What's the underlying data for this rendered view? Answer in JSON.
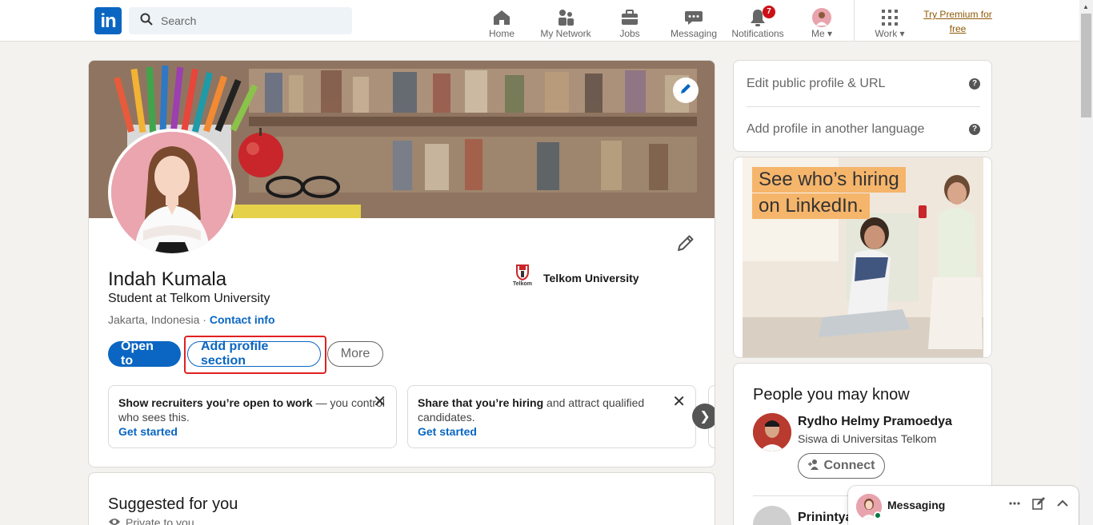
{
  "nav": {
    "logo": "in",
    "search_placeholder": "Search",
    "items": [
      {
        "label": "Home",
        "icon": "home-icon"
      },
      {
        "label": "My Network",
        "icon": "network-icon"
      },
      {
        "label": "Jobs",
        "icon": "briefcase-icon"
      },
      {
        "label": "Messaging",
        "icon": "messaging-icon"
      },
      {
        "label": "Notifications",
        "icon": "bell-icon",
        "badge": "7"
      },
      {
        "label": "Me",
        "icon": "avatar-icon"
      },
      {
        "label": "Work",
        "icon": "grid-icon"
      }
    ],
    "premium_line1": "Try Premium for",
    "premium_line2": "free"
  },
  "profile": {
    "name": "Indah Kumala",
    "headline": "Student at Telkom University",
    "location": "Jakarta, Indonesia",
    "separator": "·",
    "contact_info": "Contact info",
    "education": "Telkom University",
    "education_logo_text": "Telkom",
    "buttons": {
      "open_to": "Open to",
      "add_section": "Add profile section",
      "more": "More"
    },
    "promos": [
      {
        "bold": "Show recruiters you’re open to work",
        "rest": " — you control who sees this.",
        "cta": "Get started"
      },
      {
        "bold": "Share that you’re hiring",
        "rest": " and attract qualified candidates.",
        "cta": "Get started"
      }
    ]
  },
  "suggested": {
    "title": "Suggested for you",
    "sub": "Private to you"
  },
  "rail": {
    "links": [
      "Edit public profile & URL",
      "Add profile in another language"
    ],
    "ad_line1": "See who’s hiring",
    "ad_line2": "on LinkedIn.",
    "pymk_title": "People you may know",
    "people": [
      {
        "name": "Rydho Helmy Pramoedya",
        "desc": "Siswa di Universitas Telkom",
        "action": "Connect"
      },
      {
        "name": "Prinintya"
      }
    ]
  },
  "messaging": {
    "label": "Messaging"
  },
  "colors": {
    "brand": "#0a66c2",
    "background": "#f3f2ef",
    "highlight": "#e02020",
    "badge": "#cc1016"
  }
}
